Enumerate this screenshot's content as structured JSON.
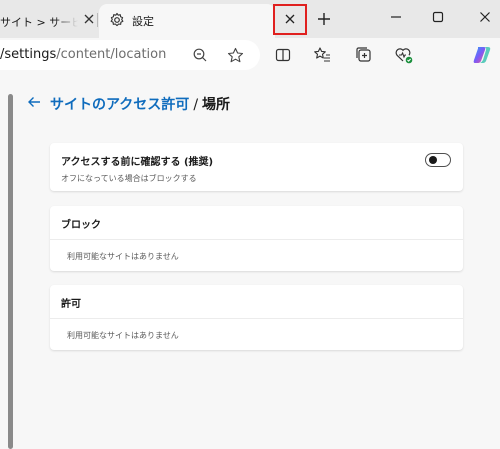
{
  "tabs": {
    "inactive_title": "サイト > サービス&",
    "active_title": "設定"
  },
  "address": {
    "domain": "/settings",
    "path": "/content/location"
  },
  "page": {
    "breadcrumb_parent": "サイトのアクセス許可",
    "separator": "/",
    "current": "場所"
  },
  "ask_card": {
    "title": "アクセスする前に確認する (推奨)",
    "subtitle": "オフになっている場合はブロックする",
    "toggle_on": false
  },
  "block_card": {
    "title": "ブロック",
    "empty_text": "利用可能なサイトはありません"
  },
  "allow_card": {
    "title": "許可",
    "empty_text": "利用可能なサイトはありません"
  },
  "colors": {
    "accent": "#0f6cbd",
    "highlight": "#e0201f"
  }
}
